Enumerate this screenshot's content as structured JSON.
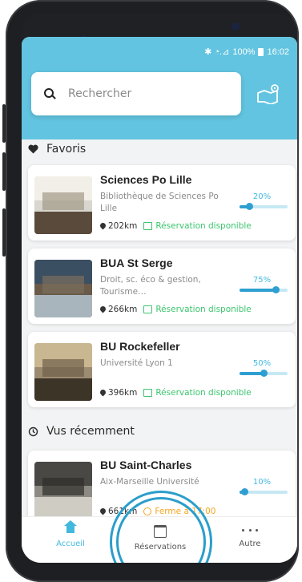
{
  "status_bar": {
    "signal": "✱ ◔.⊿",
    "battery": "100%",
    "time": "16:02"
  },
  "search": {
    "placeholder": "Rechercher"
  },
  "sections": {
    "favorites": "Favoris",
    "recent": "Vus récemment"
  },
  "favorites": [
    {
      "title": "Sciences Po Lille",
      "subtitle": "Bibliothèque de Sciences Po Lille",
      "distance": "202km",
      "status": "Réservation disponible",
      "status_kind": "available",
      "percent_label": "20%",
      "occupancy": 0.2
    },
    {
      "title": "BUA St Serge",
      "subtitle": "Droit, sc. éco & gestion, Tourisme…",
      "distance": "266km",
      "status": "Réservation disponible",
      "status_kind": "available",
      "percent_label": "75%",
      "occupancy": 0.75
    },
    {
      "title": "BU Rockefeller",
      "subtitle": "Université Lyon 1",
      "distance": "396km",
      "status": "Réservation disponible",
      "status_kind": "available",
      "percent_label": "50%",
      "occupancy": 0.5
    }
  ],
  "recent": [
    {
      "title": "BU Saint-Charles",
      "subtitle": "Aix-Marseille Université",
      "distance": "661km",
      "status": "Ferme à 17:00",
      "status_kind": "closing",
      "percent_label": "10%",
      "occupancy": 0.1
    }
  ],
  "nav": {
    "home": "Accueil",
    "reservations": "Réservations",
    "more": "Autre"
  },
  "colors": {
    "header": "#62c4e0",
    "accent": "#43b8de",
    "available": "#3cc56f",
    "warning": "#f5a623"
  }
}
